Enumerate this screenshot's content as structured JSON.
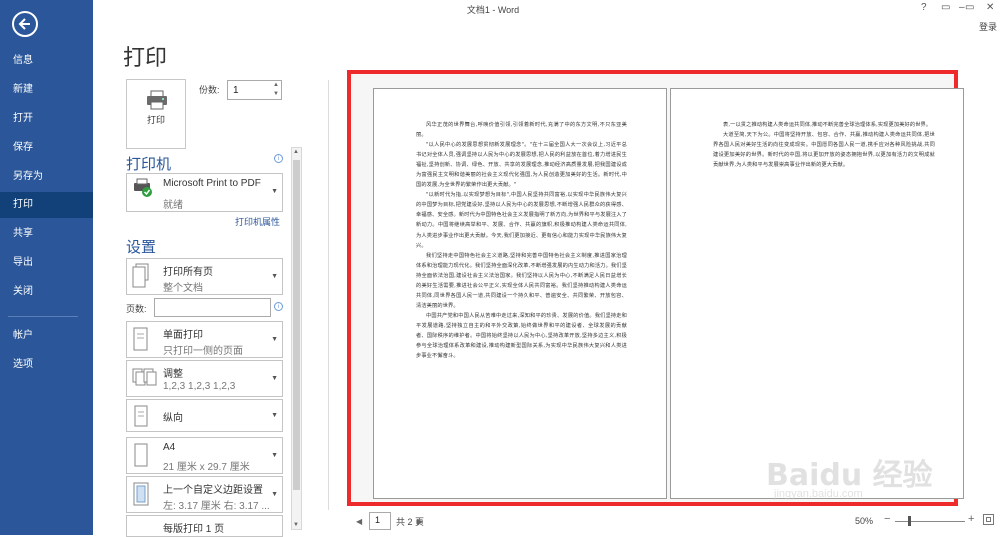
{
  "window": {
    "title": "文档1 - Word",
    "controls": [
      "?",
      "▭",
      "–",
      "▭",
      "✕"
    ],
    "login": "登录"
  },
  "nav": {
    "items": [
      {
        "label": "信息"
      },
      {
        "label": "新建"
      },
      {
        "label": "打开"
      },
      {
        "label": "保存"
      },
      {
        "label": "另存为"
      },
      {
        "label": "打印",
        "active": true
      },
      {
        "label": "共享"
      },
      {
        "label": "导出"
      },
      {
        "label": "关闭"
      },
      {
        "label": "帐户"
      },
      {
        "label": "选项"
      }
    ]
  },
  "print": {
    "heading": "打印",
    "button_label": "打印",
    "copies_label": "份数:",
    "copies_value": "1"
  },
  "printer": {
    "heading": "打印机",
    "name": "Microsoft Print to PDF",
    "status": "就绪",
    "properties_link": "打印机属性"
  },
  "settings": {
    "heading": "设置",
    "range": {
      "t1": "打印所有页",
      "t2": "整个文档"
    },
    "pages_label": "页数:",
    "pages_value": "",
    "sides": {
      "t1": "单面打印",
      "t2": "只打印一侧的页面"
    },
    "collate": {
      "t1": "调整",
      "t2": "1,2,3    1,2,3    1,2,3"
    },
    "orientation": {
      "t1": "纵向"
    },
    "paper": {
      "t1": "A4",
      "t2": "21 厘米 x 29.7 厘米"
    },
    "margins": {
      "t1": "上一个自定义边距设置",
      "t2": "左: 3.17 厘米    右: 3.17 ..."
    },
    "per_sheet": {
      "t1": "每版打印 1 页"
    }
  },
  "preview": {
    "page1": [
      "风华正茂的世界舞台,呼唤价值引领,引领着新时代,充满了中的东方文明,不只东亚美丽。",
      "\"以人民中心的发展思想贯彻新发展理念\"。\"在十三届全国人大一次会议上,习近平总书记对全体人员,强调坚持以人民为中心的发展思想,把人民的利益放在首位,着力增进民生福祉,坚持创新、协调、绿色、开放、共享的发展理念,推动经济高质量发展,把我国建设成为富强民主文明和谐美丽的社会主义现代化强国,为人民创造更加美好的生活。新时代,中国的发展,为全世界的繁荣作出更大贡献。\"",
      "\"以新时代为指,以实现梦想为目标\",中国人民坚持共同富裕,以实现中华民族伟大复兴的中国梦为目标,把党建设好,坚持以人民为中心的发展思想,不断增强人民群众的获得感、幸福感、安全感。新时代为中国特色社会主义发展指明了新方向,为世界和平与发展注入了新动力。中国将继续高举和平、发展、合作、共赢的旗帜,积极推动构建人类命运共同体,为人类进步事业作出更大贡献。今天,我们更加接近、更有信心和能力实现中华民族伟大复兴。",
      "我们坚持走中国特色社会主义道路,坚持和完善中国特色社会主义制度,推进国家治理体系和治理能力现代化。我们坚持全面深化改革,不断增强发展的内生动力和活力。我们坚持全面依法治国,建设社会主义法治国家。我们坚持以人民为中心,不断满足人民日益增长的美好生活需要,推进社会公平正义,实现全体人民共同富裕。我们坚持推动构建人类命运共同体,同世界各国人民一道,共同建设一个持久和平、普遍安全、共同繁荣、开放包容、清洁美丽的世界。",
      "中国共产党和中国人民从苦难中走过来,深知和平的珍贵、发展的价值。我们坚持走和平发展道路,坚持独立自主的和平外交政策,始终做世界和平的建设者、全球发展的贡献者、国际秩序的维护者。中国将始终坚持以人民为中心,坚持改革开放,坚持多边主义,积极参与全球治理体系改革和建设,推动构建新型国际关系,为实现中华民族伟大复兴和人类进步事业不懈奋斗。"
    ],
    "page2": [
      "表,一以贯之推动构建人类命运共同体,推动不断完善全球治理体系,实现更加美好的世界。",
      "大道至简,天下为公。中国将坚持开放、包容、合作、共赢,推动构建人类命运共同体,把世界各国人民对美好生活的向往变成现实。中国愿同各国人民一道,携手应对各种风险挑战,共同建设更加美好的世界。新时代的中国,将以更加开放的姿态拥抱世界,以更加有活力的文明成就贡献世界,为人类和平与发展崇高事业作出新的更大贡献。"
    ]
  },
  "pager": {
    "prev": "◀",
    "current": "1",
    "total": "共 2 页",
    "next": "▶"
  },
  "zoom": {
    "value": "50%",
    "level": 0.2
  },
  "watermark": {
    "text": "Baidu 经验",
    "url": "jingyan.baidu.com"
  }
}
